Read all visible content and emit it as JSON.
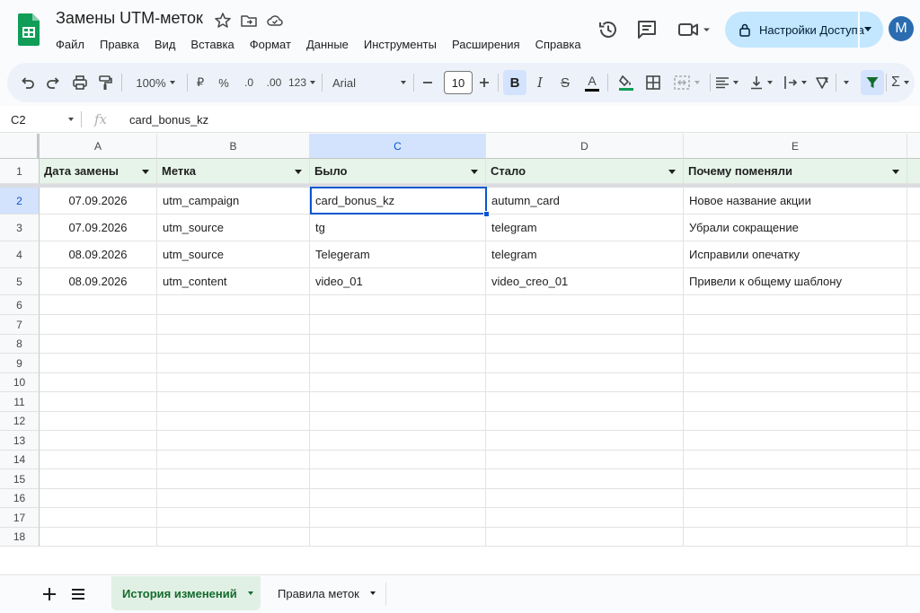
{
  "header": {
    "title": "Замены UTM-меток",
    "menu": [
      "Файл",
      "Правка",
      "Вид",
      "Вставка",
      "Формат",
      "Данные",
      "Инструменты",
      "Расширения",
      "Справка"
    ],
    "share_label": "Настройки Доступа",
    "avatar_letter": "M",
    "colors": {
      "accent": "#c2e7ff",
      "avatar": "#2b6cb0",
      "sheets_green": "#0f9d58"
    }
  },
  "toolbar": {
    "zoom": "100%",
    "currency": "₽",
    "percent": "%",
    "dec_decrease": ".0",
    "dec_increase": ".00",
    "number_format": "123",
    "font": "Arial",
    "font_size": "10",
    "bold": "B",
    "italic": "I",
    "strike": "S",
    "text_color": "A",
    "sum": "Σ",
    "icons": [
      "undo-icon",
      "redo-icon",
      "print-icon",
      "paint-format-icon",
      "minus-icon",
      "plus-icon",
      "fill-color-icon",
      "borders-icon",
      "merge-icon",
      "align-icon",
      "valign-icon",
      "wrap-icon",
      "rotate-icon",
      "filter-icon",
      "functions-icon"
    ]
  },
  "formula_bar": {
    "name_box": "C2",
    "fx": "fx",
    "value": "card_bonus_kz"
  },
  "grid": {
    "columns": [
      "A",
      "B",
      "C",
      "D",
      "E"
    ],
    "selected_column": "C",
    "selected_row": "2",
    "row_numbers": [
      "1",
      "2",
      "3",
      "4",
      "5",
      "6",
      "7",
      "8",
      "9",
      "10",
      "11",
      "12",
      "13",
      "14",
      "15",
      "16",
      "17",
      "18"
    ],
    "headers": [
      "Дата замены",
      "Метка",
      "Было",
      "Стало",
      "Почему поменяли"
    ],
    "rows": [
      [
        "07.09.2026",
        "utm_campaign",
        "card_bonus_kz",
        "autumn_card",
        "Новое название акции"
      ],
      [
        "07.09.2026",
        "utm_source",
        "tg",
        "telegram",
        "Убрали сокращение"
      ],
      [
        "08.09.2026",
        "utm_source",
        "Telegeram",
        "telegram",
        "Исправили опечатку"
      ],
      [
        "08.09.2026",
        "utm_content",
        "video_01",
        "video_creo_01",
        "Привели к общему шаблону"
      ]
    ],
    "header_fill": "#e6f4ea",
    "selection_color": "#0b57d0"
  },
  "sheets": {
    "tabs": [
      "История изменений",
      "Правила меток"
    ],
    "active": 0
  }
}
